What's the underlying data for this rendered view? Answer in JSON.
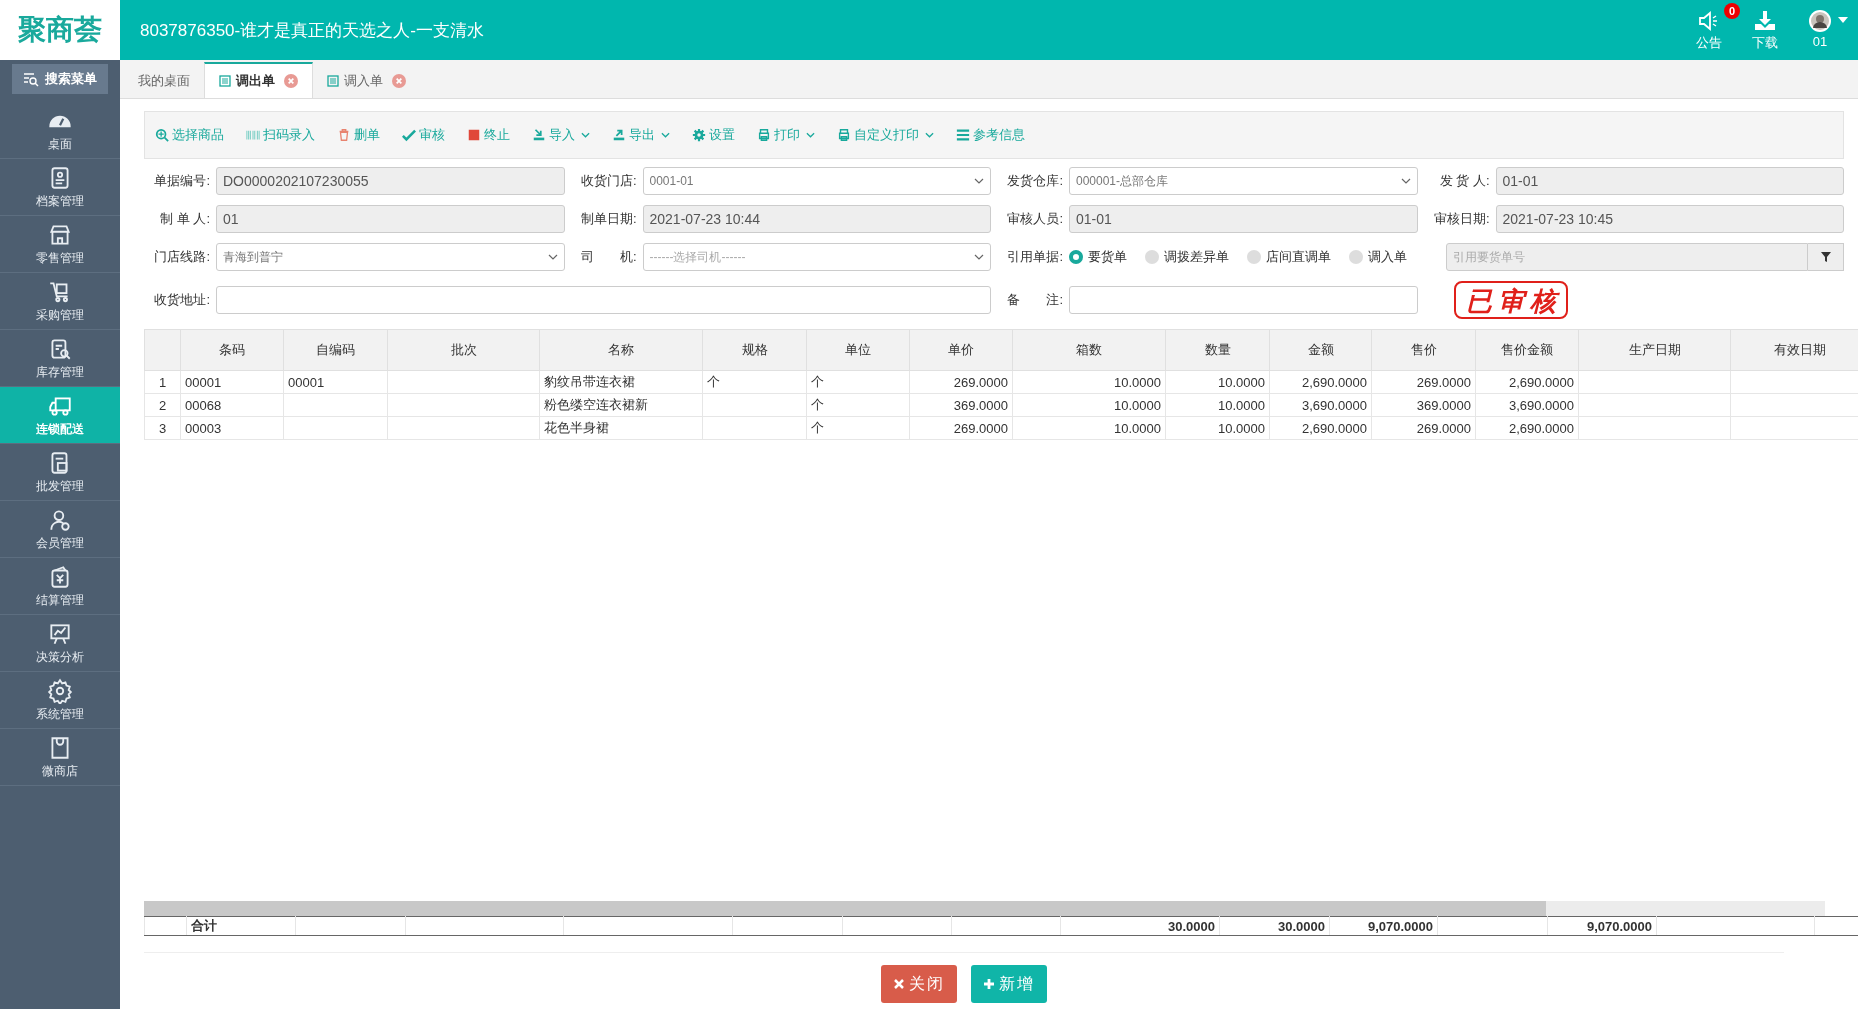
{
  "header": {
    "logo": "聚商荟",
    "title": "8037876350-谁才是真正的天选之人-一支清水",
    "notice": {
      "label": "公告",
      "badge": "0"
    },
    "download": {
      "label": "下载"
    },
    "user": {
      "label": "01"
    }
  },
  "sidebar": {
    "search": "搜索菜单",
    "items": [
      {
        "label": "桌面",
        "selected": false
      },
      {
        "label": "档案管理",
        "selected": false
      },
      {
        "label": "零售管理",
        "selected": false
      },
      {
        "label": "采购管理",
        "selected": false
      },
      {
        "label": "库存管理",
        "selected": false
      },
      {
        "label": "连锁配送",
        "selected": true
      },
      {
        "label": "批发管理",
        "selected": false
      },
      {
        "label": "会员管理",
        "selected": false
      },
      {
        "label": "结算管理",
        "selected": false
      },
      {
        "label": "决策分析",
        "selected": false
      },
      {
        "label": "系统管理",
        "selected": false
      },
      {
        "label": "微商店",
        "selected": false
      }
    ]
  },
  "tabs": [
    {
      "label": "我的桌面",
      "selected": false,
      "closable": false
    },
    {
      "label": "调出单",
      "selected": true,
      "closable": true
    },
    {
      "label": "调入单",
      "selected": false,
      "closable": true
    }
  ],
  "toolbar": [
    {
      "label": "选择商品",
      "dropdown": false
    },
    {
      "label": "扫码录入",
      "dropdown": false
    },
    {
      "label": "删单",
      "dropdown": false
    },
    {
      "label": "审核",
      "dropdown": false
    },
    {
      "label": "终止",
      "dropdown": false
    },
    {
      "label": "导入",
      "dropdown": true
    },
    {
      "label": "导出",
      "dropdown": true
    },
    {
      "label": "设置",
      "dropdown": false
    },
    {
      "label": "打印",
      "dropdown": true
    },
    {
      "label": "自定义打印",
      "dropdown": true
    },
    {
      "label": "参考信息",
      "dropdown": false
    }
  ],
  "form": {
    "rows": [
      [
        {
          "label": "单据编号:",
          "kind": "readonly",
          "value": "DO0000202107230055"
        },
        {
          "label": "收货门店:",
          "kind": "select",
          "value": "0001-01"
        },
        {
          "label": "发货仓库:",
          "kind": "select",
          "value": "000001-总部仓库"
        },
        {
          "label": "发 货 人:",
          "kind": "readonly",
          "value": "01-01"
        }
      ],
      [
        {
          "label": "制 单 人:",
          "kind": "readonly",
          "value": "01"
        },
        {
          "label": "制单日期:",
          "kind": "readonly",
          "value": "2021-07-23 10:44"
        },
        {
          "label": "审核人员:",
          "kind": "readonly",
          "value": "01-01"
        },
        {
          "label": "审核日期:",
          "kind": "readonly",
          "value": "2021-07-23 10:45"
        }
      ],
      [
        {
          "label": "门店线路:",
          "kind": "select",
          "value": "青海到普宁"
        },
        {
          "label": "司　　机:",
          "kind": "select",
          "placeholder": "------选择司机------"
        },
        {
          "label": "引用单据:",
          "kind": "radio",
          "options": [
            {
              "label": "要货单",
              "selected": true
            },
            {
              "label": "调拨差异单",
              "selected": false
            },
            {
              "label": "店间直调单",
              "selected": false
            },
            {
              "label": "调入单",
              "selected": false
            }
          ]
        },
        {
          "kind": "lookup",
          "placeholder": "引用要货单号"
        }
      ],
      [
        {
          "label": "收货地址:",
          "kind": "wide"
        },
        {
          "kind": "gap"
        },
        {
          "label": "备　　注:",
          "kind": "input"
        }
      ]
    ]
  },
  "stamp": {
    "text": "已审核"
  },
  "table": {
    "columns": [
      {
        "label": "条码",
        "numeric": false
      },
      {
        "label": "自编码",
        "numeric": false
      },
      {
        "label": "批次"
      },
      {
        "label": "名称",
        "numeric": false
      },
      {
        "label": "规格",
        "numeric": false
      },
      {
        "label": "单位",
        "numeric": false
      },
      {
        "label": "单价",
        "numeric": true
      },
      {
        "label": "箱数",
        "numeric": true,
        "total": "30.0000"
      },
      {
        "label": "数量",
        "numeric": true,
        "total": "30.0000"
      },
      {
        "label": "金额",
        "numeric": true,
        "total": "9,070.0000"
      },
      {
        "label": "售价",
        "numeric": true
      },
      {
        "label": "售价金额",
        "numeric": true,
        "total": "9,070.0000"
      },
      {
        "label": "生产日期"
      },
      {
        "label": "有效日期"
      }
    ],
    "rows": [
      {
        "no": "1",
        "cells": [
          "00001",
          "00001",
          null,
          "豹纹吊带连衣裙",
          "个",
          "个",
          "269.0000",
          "10.0000",
          "10.0000",
          "2,690.0000",
          "269.0000",
          "2,690.0000",
          null,
          null
        ]
      },
      {
        "no": "2",
        "cells": [
          "00068",
          null,
          null,
          "粉色缕空连衣裙新",
          null,
          "个",
          "369.0000",
          "10.0000",
          "10.0000",
          "3,690.0000",
          "369.0000",
          "3,690.0000",
          null,
          null
        ]
      },
      {
        "no": "3",
        "cells": [
          "00003",
          null,
          null,
          "花色半身裙",
          null,
          "个",
          "269.0000",
          "10.0000",
          "10.0000",
          "2,690.0000",
          "269.0000",
          "2,690.0000",
          null,
          null
        ]
      }
    ],
    "totals_label": "合计"
  },
  "buttons": [
    {
      "label": "关闭",
      "kind": "danger"
    },
    {
      "label": "新增",
      "kind": "primary"
    }
  ]
}
